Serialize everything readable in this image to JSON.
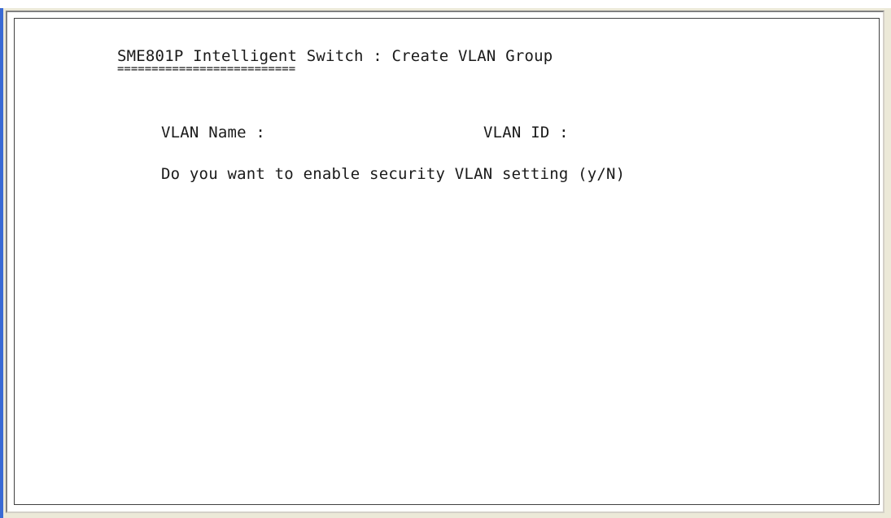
{
  "screen": {
    "title": "SME801P Intelligent Switch : Create VLAN Group",
    "title_underline": "==========================",
    "fields": {
      "vlan_name_label": "VLAN Name :",
      "vlan_id_label": "VLAN ID :"
    },
    "prompt": "Do you want to enable security VLAN setting (y/N)"
  },
  "colors": {
    "background": "#ffffff",
    "text": "#1a1a1a",
    "window_frame": "#ece9d8",
    "accent": "#3a6ad4"
  }
}
